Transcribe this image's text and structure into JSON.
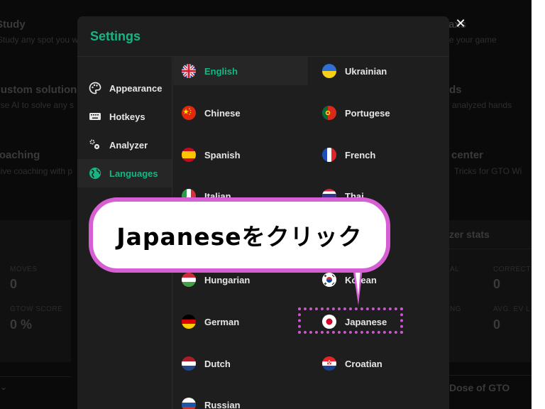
{
  "background": {
    "cards_left": [
      {
        "title": "Study",
        "subtitle": "Study any spot you w"
      },
      {
        "title": "Custom solutions",
        "subtitle": "Use AI to solve any s"
      },
      {
        "title": "Coaching",
        "subtitle": "Live coaching with p"
      }
    ],
    "cards_right": [
      {
        "title": "axs",
        "subtitle": "e your game"
      },
      {
        "title": "ds",
        "subtitle": "analyzed hands"
      },
      {
        "title": "center",
        "subtitle": "Tricks for GTO Wi"
      }
    ],
    "stats_left": [
      {
        "label": "MOVES",
        "value": "0"
      },
      {
        "label": "GTOW SCORE",
        "value": "0 %"
      }
    ],
    "stats_right_header": "zer stats",
    "stats_right": [
      {
        "label": "AL",
        "value": ""
      },
      {
        "label": "CORRECT",
        "value": "0"
      },
      {
        "label": "NG",
        "value": ""
      },
      {
        "label": "AVG. EV L",
        "value": "0"
      }
    ],
    "footer_right": "Dose of GTO"
  },
  "modal": {
    "title": "Settings",
    "close_icon": "close-icon",
    "sidebar": [
      {
        "label": "Appearance",
        "icon": "palette-icon",
        "active": false
      },
      {
        "label": "Hotkeys",
        "icon": "keyboard-icon",
        "active": false
      },
      {
        "label": "Analyzer",
        "icon": "gears-icon",
        "active": false
      },
      {
        "label": "Languages",
        "icon": "globe-icon",
        "active": true
      }
    ],
    "languages": [
      {
        "label": "English",
        "flag": "uk-flag-icon",
        "active": true
      },
      {
        "label": "Ukrainian",
        "flag": "ukraine-flag-icon",
        "active": false
      },
      {
        "label": "Chinese",
        "flag": "china-flag-icon",
        "active": false
      },
      {
        "label": "Portugese",
        "flag": "portugal-flag-icon",
        "active": false
      },
      {
        "label": "Spanish",
        "flag": "spain-flag-icon",
        "active": false
      },
      {
        "label": "French",
        "flag": "france-flag-icon",
        "active": false
      },
      {
        "label": "Italian",
        "flag": "italy-flag-icon",
        "active": false
      },
      {
        "label": "Thai",
        "flag": "thailand-flag-icon",
        "active": false
      },
      {
        "label": "Hungarian",
        "flag": "hungary-flag-icon",
        "active": false
      },
      {
        "label": "Korean",
        "flag": "korea-flag-icon",
        "active": false
      },
      {
        "label": "German",
        "flag": "germany-flag-icon",
        "active": false
      },
      {
        "label": "Japanese",
        "flag": "japan-flag-icon",
        "active": false
      },
      {
        "label": "Dutch",
        "flag": "netherlands-flag-icon",
        "active": false
      },
      {
        "label": "Croatian",
        "flag": "croatia-flag-icon",
        "active": false
      },
      {
        "label": "Russian",
        "flag": "russia-flag-icon",
        "active": false
      }
    ]
  },
  "annotation": {
    "callout_text": "Japaneseをクリック",
    "target": "Japanese"
  },
  "colors": {
    "accent": "#17b584",
    "annotation": "#d660d3",
    "modal_bg": "#1e1e1e"
  }
}
